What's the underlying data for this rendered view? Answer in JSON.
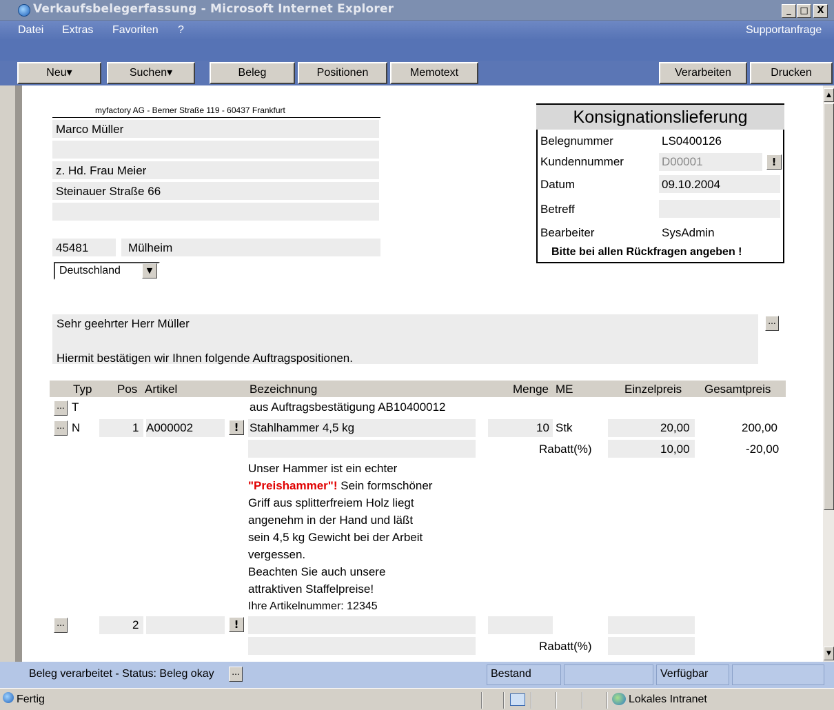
{
  "window": {
    "title": "Verkaufsbelegerfassung - Microsoft Internet Explorer",
    "min_label": "_",
    "max_label": "□",
    "close_label": "X"
  },
  "menu": {
    "items": [
      "Datei",
      "Extras",
      "Favoriten",
      "?"
    ],
    "right": "Supportanfrage"
  },
  "toolbar": {
    "new_label": "Neu▾",
    "search_label": "Suchen▾",
    "beleg_label": "Beleg",
    "positionen_label": "Positionen",
    "memotext_label": "Memotext",
    "verarbeiten_label": "Verarbeiten",
    "drucken_label": "Drucken"
  },
  "address": {
    "sender_line": "myfactory AG - Berner Straße 119 - 60437 Frankfurt",
    "name": "Marco Müller",
    "line2": "",
    "attention": "z. Hd. Frau Meier",
    "street": "Steinauer Straße 66",
    "line5": "",
    "zip": "45481",
    "city": "Mülheim",
    "country": "Deutschland"
  },
  "doc": {
    "type_title": "Konsignationslieferung",
    "belegnummer_label": "Belegnummer",
    "belegnummer": "LS0400126",
    "kundennummer_label": "Kundennummer",
    "kundennummer": "D00001",
    "datum_label": "Datum",
    "datum": "09.10.2004",
    "betreff_label": "Betreff",
    "betreff": "",
    "bearbeiter_label": "Bearbeiter",
    "bearbeiter": "SysAdmin",
    "note": "Bitte bei allen Rückfragen angeben !"
  },
  "letter": {
    "salutation": "Sehr geehrter Herr Müller",
    "intro": "Hiermit bestätigen wir Ihnen folgende Auftragspositionen."
  },
  "table": {
    "headers": {
      "typ": "Typ",
      "pos": "Pos",
      "artikel": "Artikel",
      "bezeichnung": "Bezeichnung",
      "menge": "Menge",
      "me": "ME",
      "einzelpreis": "Einzelpreis",
      "gesamtpreis": "Gesamtpreis"
    },
    "row_text": {
      "typ": "T",
      "bezeichnung": "aus Auftragsbestätigung AB10400012"
    },
    "row1": {
      "typ": "N",
      "pos": "1",
      "artikel": "A000002",
      "bezeichnung": "Stahlhammer 4,5 kg",
      "menge": "10",
      "me": "Stk",
      "einzelpreis": "20,00",
      "gesamtpreis": "200,00",
      "rabatt_label": "Rabatt(%)",
      "rabatt": "10,00",
      "rabatt_betrag": "-20,00",
      "memo_part1": "Unser Hammer ist ein echter",
      "memo_highlight": "\"Preishammer\"!",
      "memo_part2": " Sein formschöner",
      "memo_line3": "Griff aus splitterfreiem Holz liegt",
      "memo_line4": "angenehm in der Hand und läßt",
      "memo_line5": "sein 4,5 kg Gewicht bei der Arbeit",
      "memo_line6": "vergessen.",
      "memo_line7": "Beachten Sie auch unsere",
      "memo_line8": "attraktiven Staffelpreise!",
      "memo_line9": "Ihre Artikelnummer: 12345"
    },
    "row2": {
      "pos": "2",
      "rabatt_label": "Rabatt(%)"
    },
    "btn_more": "...",
    "btn_excl": "!"
  },
  "statusbar": {
    "status_text": "Beleg verarbeitet - Status: Beleg okay",
    "bestand_label": "Bestand",
    "verfuegbar_label": "Verfügbar"
  },
  "footer": {
    "status": "Fertig",
    "zone": "Lokales Intranet"
  },
  "colors": {
    "highlight_red": "#e00000",
    "menubar": "#5673b5"
  }
}
